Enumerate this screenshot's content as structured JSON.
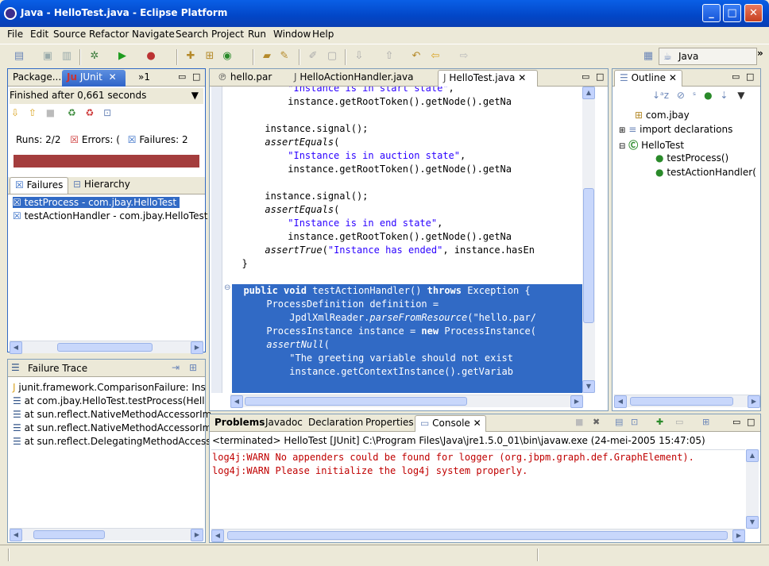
{
  "window": {
    "title": "Java - HelloTest.java - Eclipse Platform"
  },
  "menu": [
    "File",
    "Edit",
    "Source",
    "Refactor",
    "Navigate",
    "Search",
    "Project",
    "Run",
    "Window",
    "Help"
  ],
  "toolbar": {
    "perspective_label": "Java",
    "overflow": "»"
  },
  "left_panel": {
    "tabs": [
      {
        "label": "Package..."
      },
      {
        "label": "JUnit"
      }
    ],
    "overflow": "»1",
    "status": "Finished after 0,661 seconds",
    "runs_label": "Runs:",
    "runs_value": "2/2",
    "errors_label": "Errors:",
    "errors_value": "(",
    "failures_label": "Failures:",
    "failures_value": "2",
    "view_tabs": [
      {
        "label": "Failures"
      },
      {
        "label": "Hierarchy"
      }
    ],
    "tests": [
      "testProcess - com.jbay.HelloTest",
      "testActionHandler - com.jbay.HelloTest"
    ],
    "failure_trace_title": "Failure Trace",
    "trace": [
      "junit.framework.ComparisonFailure: Ins",
      "at com.jbay.HelloTest.testProcess(Hell",
      "at sun.reflect.NativeMethodAccessorIm",
      "at sun.reflect.NativeMethodAccessorIm",
      "at sun.reflect.DelegatingMethodAccesso"
    ]
  },
  "editor": {
    "tabs": [
      {
        "label": "hello.par"
      },
      {
        "label": "HelloActionHandler.java"
      },
      {
        "label": "HelloTest.java"
      }
    ]
  },
  "outline": {
    "title": "Outline",
    "items": [
      {
        "label": "com.jbay"
      },
      {
        "label": "import declarations"
      },
      {
        "label": "HelloTest"
      },
      {
        "label": "testProcess()"
      },
      {
        "label": "testActionHandler("
      }
    ]
  },
  "bottom": {
    "tabs": [
      {
        "label": "Problems"
      },
      {
        "label": "Javadoc"
      },
      {
        "label": "Declaration"
      },
      {
        "label": "Properties"
      },
      {
        "label": "Console"
      }
    ],
    "terminated": "<terminated> HelloTest [JUnit] C:\\Program Files\\Java\\jre1.5.0_01\\bin\\javaw.exe (24-mei-2005 15:47:05)",
    "console_lines": [
      "log4j:WARN No appenders could be found for logger (org.jbpm.graph.def.GraphElement).",
      "log4j:WARN Please initialize the log4j system properly."
    ]
  },
  "colors": {
    "accent": "#316ac5",
    "failure_bar": "#a43d3d",
    "console_error": "#c00000",
    "string": "#2a00ff",
    "keyword": "#7f0055"
  }
}
